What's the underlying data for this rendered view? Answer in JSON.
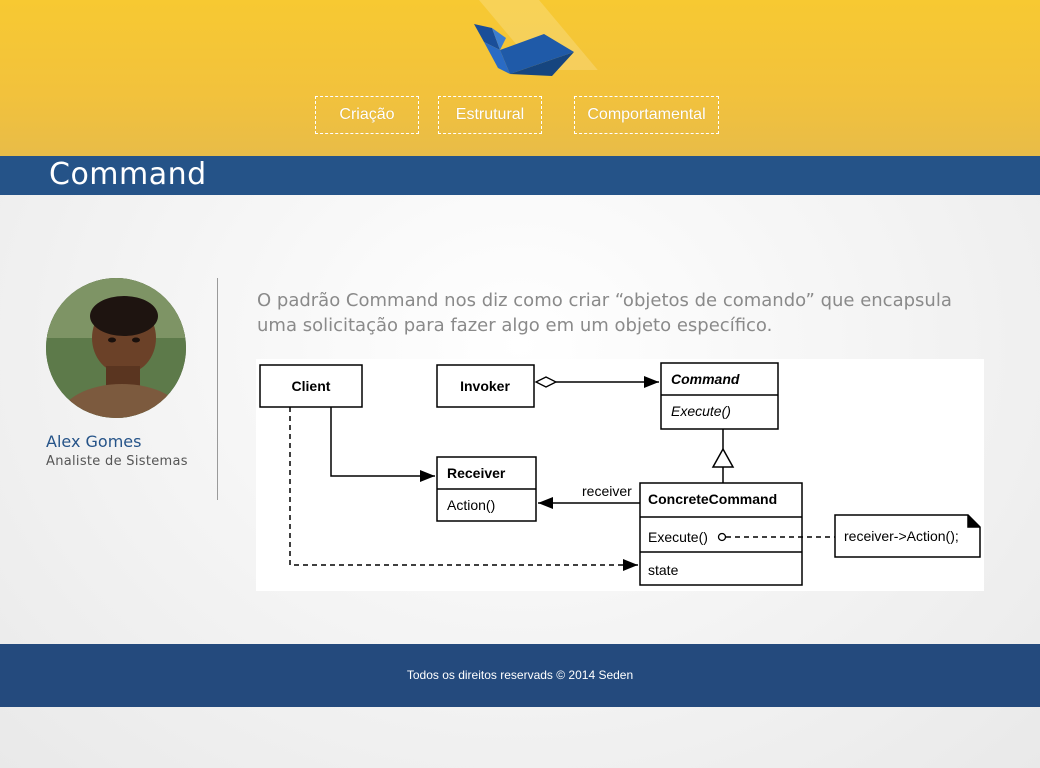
{
  "nav": {
    "items": [
      {
        "label": "Criação"
      },
      {
        "label": "Estrutural"
      },
      {
        "label": "Comportamental"
      }
    ]
  },
  "page": {
    "title": "Command",
    "description": "O padrão Command nos diz como criar “objetos de comando” que encapsula uma solicitação para fazer algo em um objeto específico."
  },
  "author": {
    "name": "Alex Gomes",
    "role": "Analiste de Sistemas"
  },
  "diagram": {
    "client": "Client",
    "invoker": "Invoker",
    "command": "Command",
    "command_execute": "Execute()",
    "receiver": "Receiver",
    "receiver_action": "Action()",
    "receiver_label": "receiver",
    "concrete": "ConcreteCommand",
    "concrete_execute": "Execute()",
    "concrete_state": "state",
    "note": "receiver->Action();"
  },
  "footer": {
    "text": "Todos os direitos reservads © 2014 Seden"
  },
  "colors": {
    "header_yellow": "#f7c932",
    "title_blue": "#255388",
    "footer_blue": "#244a7d",
    "logo_blue": "#1f5aa8"
  }
}
